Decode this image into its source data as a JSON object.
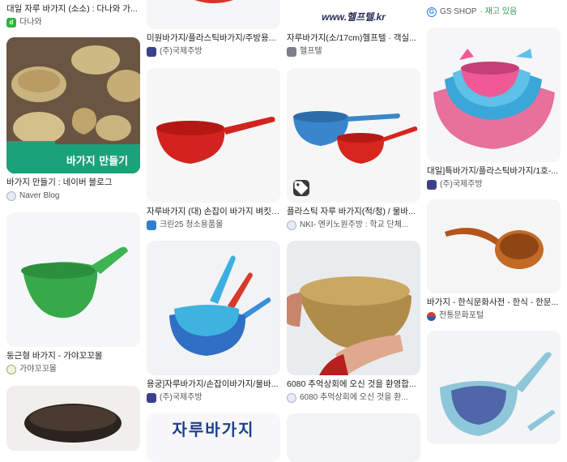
{
  "columns": [
    {
      "tiles": [
        {
          "title": "대일 자루 바가지 (소소) : 다나와 가...",
          "source": "다나와",
          "fav_color": "#2fb43a",
          "fav_text": "d"
        },
        {
          "title": "바가지 만들기 : 네이버 블로그",
          "source": "Naver Blog",
          "image_text": "바가지 만들기",
          "fav_color": "#8a94a8",
          "fav_text": ""
        },
        {
          "title": "둥근형 바가지 - 가야꼬꼬몰",
          "source": "가야꼬꼬몰",
          "fav_color": "#e8f0d8",
          "fav_text": ""
        },
        {
          "title": "",
          "source": ""
        }
      ]
    },
    {
      "tiles": [
        {
          "title": "미원바가지/플라스틱바가지/주방용...",
          "source": "(주)국제주방",
          "fav_color": "#3b3f8c",
          "fav_text": ""
        },
        {
          "title": "자루바가지 (대) 손잡이 바가지 벼킷 ...",
          "source": "크린25 청소용품몰",
          "fav_color": "#2f7fd0",
          "fav_text": ""
        },
        {
          "title": "용궁]자루바가지/손잡이바가지/물바...",
          "source": "(주)국제주방",
          "fav_color": "#3b3f8c",
          "fav_text": ""
        },
        {
          "title": "",
          "source": "",
          "image_text": "자루바가지"
        }
      ]
    },
    {
      "tiles": [
        {
          "title": "자루바가지(소/17cm)헬프텔 · 객실...",
          "source": "헬프텔",
          "image_text": "www.헬프텔.kr",
          "fav_color": "#7a7f8a",
          "fav_text": ""
        },
        {
          "title": "플라스틱 자루 바가지(적/청) / 물바...",
          "source": "NKI- 엔키노원주방 : 학교 단체...",
          "fav_color": "#8a94a8",
          "fav_text": ""
        },
        {
          "title": "6080 추억상회에 오신 것을 환영합...",
          "source": "6080 추억상회에 오신 것을 환...",
          "fav_color": "#3b3f8c",
          "fav_text": ""
        },
        {
          "title": "",
          "source": ""
        }
      ]
    },
    {
      "tiles": [
        {
          "title": "",
          "source": "GS SHOP",
          "stock": "· 재고 있음",
          "fav_color": "#2a7be4",
          "fav_text": "G"
        },
        {
          "title": "대일]특바가지/플라스틱바가지/1호-...",
          "source": "(주)국제주방",
          "fav_color": "#3b3f8c",
          "fav_text": ""
        },
        {
          "title": "바가지 - 한식문화사전 - 한식 - 한문...",
          "source": "전통문화포털",
          "fav_color": "#d43b3b",
          "fav_text": ""
        },
        {
          "title": "",
          "source": ""
        }
      ]
    }
  ]
}
